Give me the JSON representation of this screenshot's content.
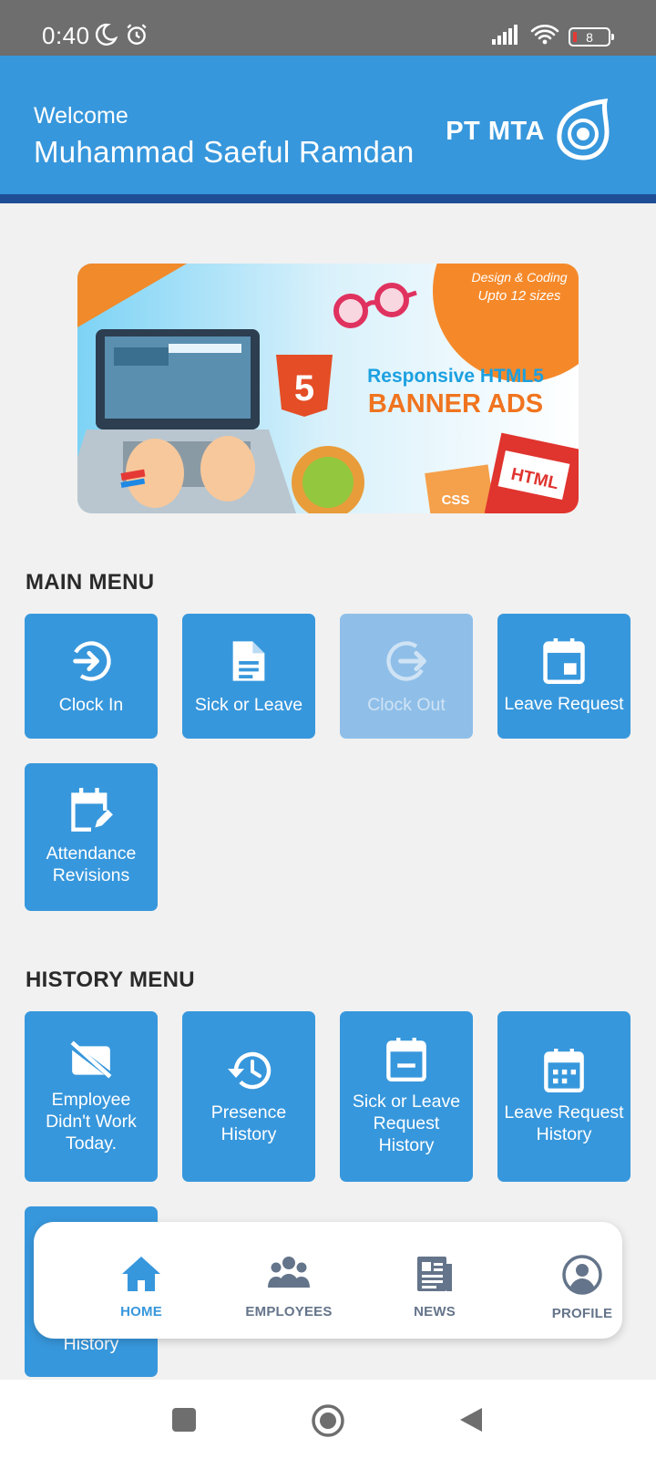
{
  "status_bar": {
    "time": "0:40",
    "battery": "8"
  },
  "header": {
    "welcome": "Welcome",
    "user_name": "Muhammad Saeful Ramdan",
    "brand": "PT MTA"
  },
  "banner": {
    "line1": "Design & Coding",
    "line2": "Upto 12 sizes",
    "line3": "Responsive HTML5",
    "line4": "BANNER ADS",
    "badge_css": "CSS",
    "badge_html": "HTML"
  },
  "main_menu": {
    "title": "MAIN MENU",
    "items": [
      {
        "label": "Clock In",
        "icon": "login-icon",
        "enabled": true
      },
      {
        "label": "Sick or Leave",
        "icon": "document-icon",
        "enabled": true
      },
      {
        "label": "Clock Out",
        "icon": "logout-icon",
        "enabled": false
      },
      {
        "label": "Leave Request",
        "icon": "calendar-event-icon",
        "enabled": true
      },
      {
        "label": "Attendance Revisions",
        "icon": "calendar-edit-icon",
        "enabled": true
      }
    ]
  },
  "history_menu": {
    "title": "HISTORY MENU",
    "items": [
      {
        "label": "Employee Didn't Work Today.",
        "icon": "badge-off-icon"
      },
      {
        "label": "Presence History",
        "icon": "history-icon"
      },
      {
        "label": "Sick or Leave Request History",
        "icon": "calendar-minus-icon"
      },
      {
        "label": "Leave Request History",
        "icon": "calendar-grid-icon"
      },
      {
        "label": "History",
        "icon": "history-icon"
      }
    ]
  },
  "bottom_nav": {
    "items": [
      {
        "label": "HOME",
        "icon": "home-icon",
        "active": true
      },
      {
        "label": "EMPLOYEES",
        "icon": "people-icon",
        "active": false
      },
      {
        "label": "NEWS",
        "icon": "newspaper-icon",
        "active": false
      },
      {
        "label": "PROFILE",
        "icon": "account-circle-icon",
        "active": false
      }
    ]
  },
  "colors": {
    "primary": "#3797dc",
    "header_border": "#1f4e96",
    "disabled": "#8fbfe8",
    "background": "#f1f1f1"
  }
}
